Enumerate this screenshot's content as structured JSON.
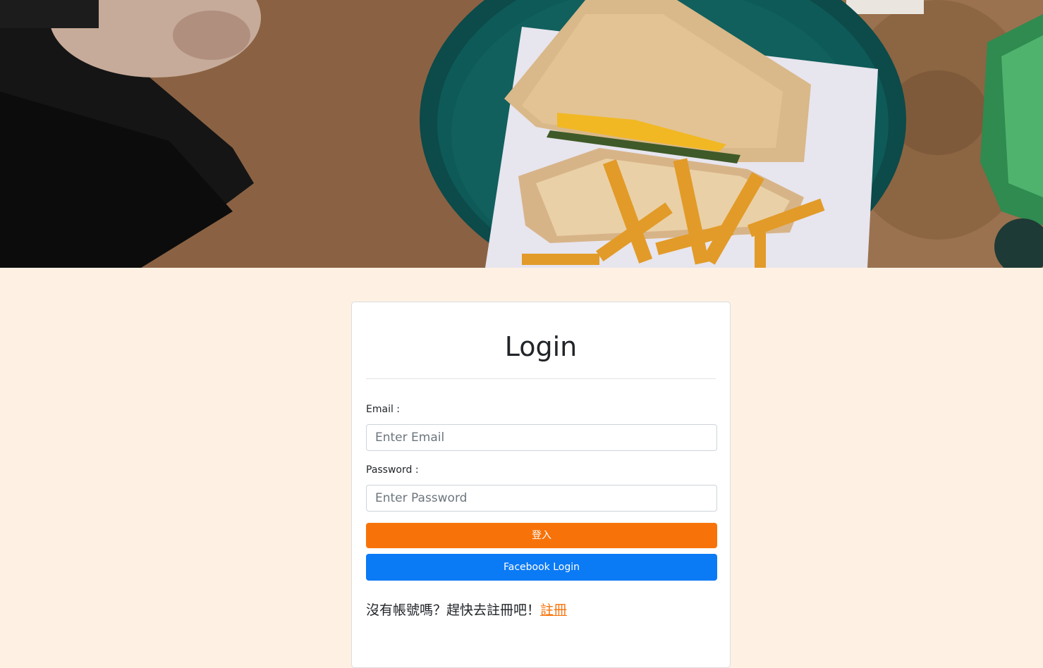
{
  "hero": {
    "image_name": "sandwich-fries-plate-photo"
  },
  "login": {
    "title": "Login",
    "email_label": "Email :",
    "email_placeholder": "Enter Email",
    "email_value": "",
    "password_label": "Password :",
    "password_placeholder": "Enter Password",
    "password_value": "",
    "login_button": "登入",
    "facebook_button": "Facebook Login",
    "signup_prompt": "沒有帳號嗎？趕快去註冊吧！",
    "signup_link": "註冊"
  },
  "colors": {
    "page_background": "#fef1e4",
    "login_button": "#f7730a",
    "facebook_button": "#0b7af5",
    "signup_link": "#f7730a"
  }
}
